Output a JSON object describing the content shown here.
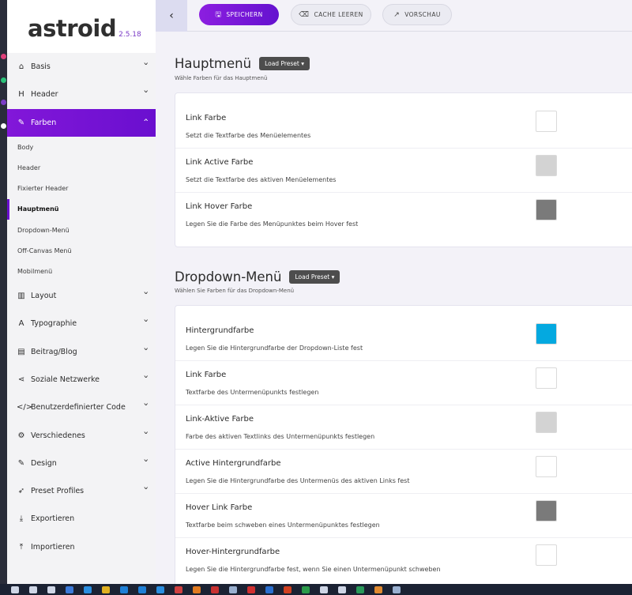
{
  "brand": {
    "name": "astroid",
    "version": "2.5.18"
  },
  "sidebar": {
    "items": [
      {
        "label": "Basis",
        "icon": "home-icon",
        "glyph": "⌂"
      },
      {
        "label": "Header",
        "icon": "header-h-icon",
        "glyph": "H"
      },
      {
        "label": "Farben",
        "icon": "paint-brush-icon",
        "glyph": "✎",
        "active": true
      },
      {
        "label": "Layout",
        "icon": "layout-columns-icon",
        "glyph": "▥"
      },
      {
        "label": "Typographie",
        "icon": "font-icon",
        "glyph": "A"
      },
      {
        "label": "Beitrag/Blog",
        "icon": "newspaper-icon",
        "glyph": "▤"
      },
      {
        "label": "Soziale Netzwerke",
        "icon": "share-icon",
        "glyph": "⋖"
      },
      {
        "label": "Benutzerdefinierter Code",
        "icon": "code-icon",
        "glyph": "</>"
      },
      {
        "label": "Verschiedenes",
        "icon": "cogs-icon",
        "glyph": "⚙"
      },
      {
        "label": "Design",
        "icon": "paint-brush-icon",
        "glyph": "✎"
      },
      {
        "label": "Preset Profiles",
        "icon": "rocket-icon",
        "glyph": "➶"
      },
      {
        "label": "Exportieren",
        "icon": "download-icon",
        "glyph": "⤓"
      },
      {
        "label": "Importieren",
        "icon": "upload-icon",
        "glyph": "⤒"
      }
    ],
    "farben_sub": [
      "Body",
      "Header",
      "Fixierter Header",
      "Hauptmenü",
      "Dropdown-Menü",
      "Off-Canvas Menü",
      "Mobilmenü"
    ],
    "current_sub": "Hauptmenü"
  },
  "toolbar": {
    "save_label": "SPEICHERN",
    "cache_label": "CACHE LEEREN",
    "preview_label": "VORSCHAU"
  },
  "sections": {
    "hauptmenu": {
      "title": "Hauptmenü",
      "preset_label": "Load Preset ▾",
      "subtitle": "Wähle Farben für das Hauptmenü",
      "rows": [
        {
          "title": "Link Farbe",
          "desc": "Setzt die Textfarbe des Menüelementes",
          "color": "#ffffff"
        },
        {
          "title": "Link Active Farbe",
          "desc": "Setzt die Textfarbe des aktiven Menüelementes",
          "color": "#d3d3d3"
        },
        {
          "title": "Link Hover Farbe",
          "desc": "Legen Sie die Farbe des Menüpunktes beim Hover fest",
          "color": "#7a7a7a"
        }
      ]
    },
    "dropdown": {
      "title": "Dropdown-Menü",
      "preset_label": "Load Preset ▾",
      "subtitle": "Wählen Sie Farben für das Dropdown-Menü",
      "rows": [
        {
          "title": "Hintergrundfarbe",
          "desc": "Legen Sie die Hintergrundfarbe der Dropdown-Liste fest",
          "color": "#04a9e0"
        },
        {
          "title": "Link Farbe",
          "desc": "Textfarbe des Untermenüpunkts festlegen",
          "color": "#ffffff"
        },
        {
          "title": "Link-Aktive Farbe",
          "desc": "Farbe des aktiven Textlinks des Untermenüpunkts festlegen",
          "color": "#d3d3d3"
        },
        {
          "title": "Active Hintergrundfarbe",
          "desc": "Legen Sie die Hintergrundfarbe des Untermenüs des aktiven Links fest",
          "color": "#ffffff"
        },
        {
          "title": "Hover Link Farbe",
          "desc": "Textfarbe beim schweben eines Untermenüpunktes festlegen",
          "color": "#7a7a7a"
        },
        {
          "title": "Hover-Hintergrundfarbe",
          "desc": "Legen Sie die Hintergrundfarbe fest, wenn Sie einen Untermenüpunkt schweben",
          "color": "#ffffff"
        }
      ]
    }
  },
  "colors": {
    "accent": "#7a16d6",
    "accent_dark": "#6412cf"
  }
}
